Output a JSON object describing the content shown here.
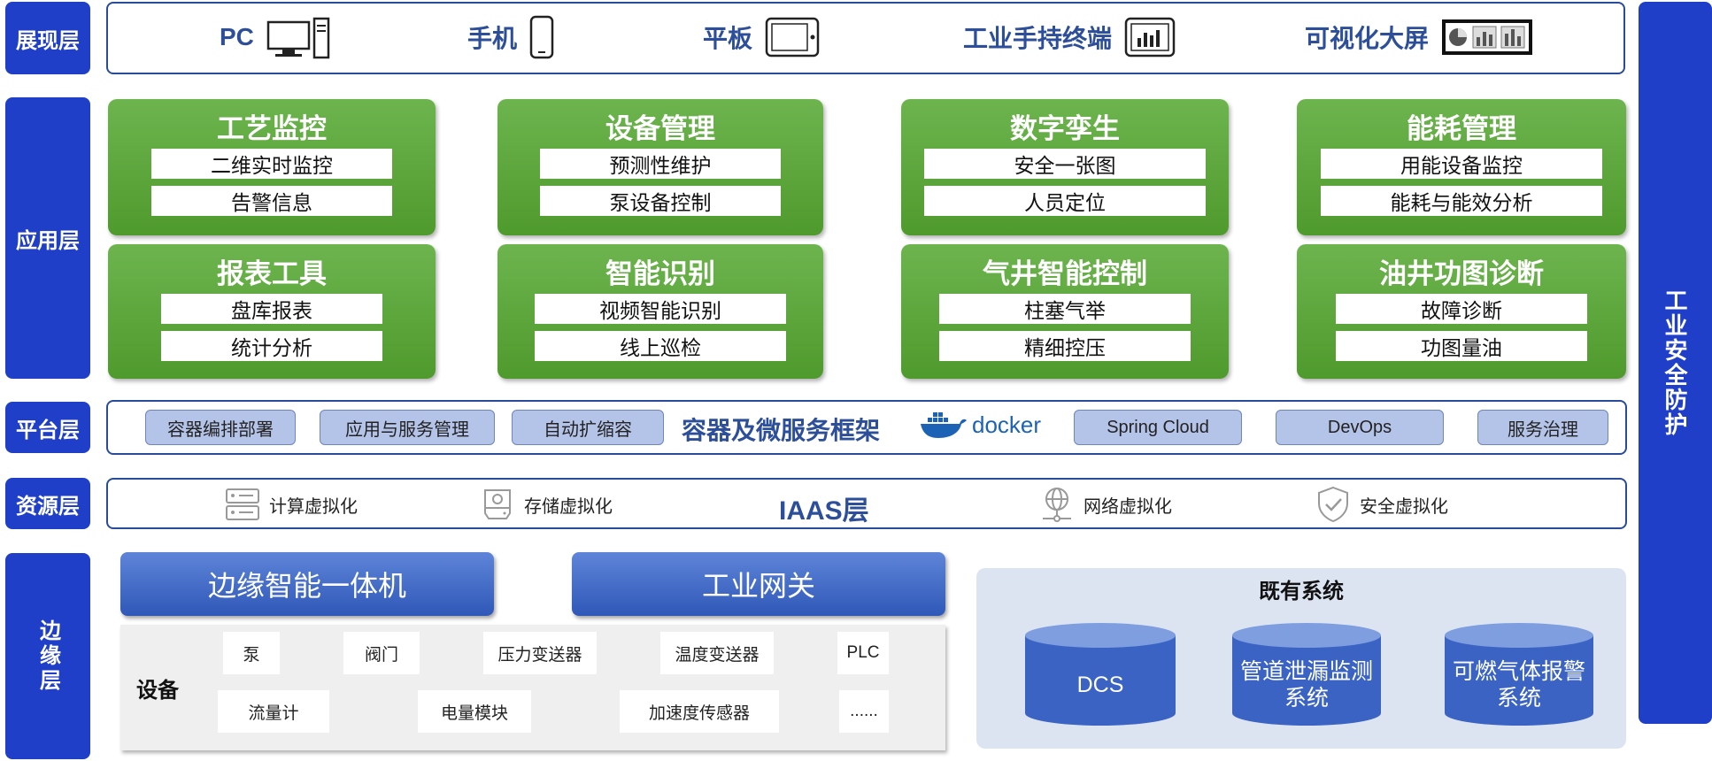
{
  "layers": {
    "presentation": "展现层",
    "application": "应用层",
    "platform": "平台层",
    "resource": "资源层",
    "edge": "边缘层"
  },
  "security": "工业安全防护",
  "presentation": {
    "devices": [
      {
        "label": "PC",
        "icon": "pc-icon"
      },
      {
        "label": "手机",
        "icon": "phone-icon"
      },
      {
        "label": "平板",
        "icon": "tablet-icon"
      },
      {
        "label": "工业手持终端",
        "icon": "handheld-terminal-icon"
      },
      {
        "label": "可视化大屏",
        "icon": "big-screen-icon"
      }
    ]
  },
  "application": {
    "modules": [
      {
        "title": "工艺监控",
        "items": [
          "二维实时监控",
          "告警信息"
        ]
      },
      {
        "title": "设备管理",
        "items": [
          "预测性维护",
          "泵设备控制"
        ]
      },
      {
        "title": "数字孪生",
        "items": [
          "安全一张图",
          "人员定位"
        ]
      },
      {
        "title": "能耗管理",
        "items": [
          "用能设备监控",
          "能耗与能效分析"
        ]
      },
      {
        "title": "报表工具",
        "items": [
          "盘库报表",
          "统计分析"
        ]
      },
      {
        "title": "智能识别",
        "items": [
          "视频智能识别",
          "线上巡检"
        ]
      },
      {
        "title": "气井智能控制",
        "items": [
          "柱塞气举",
          "精细控压"
        ]
      },
      {
        "title": "油井功图诊断",
        "items": [
          "故障诊断",
          "功图量油"
        ]
      }
    ]
  },
  "platform": {
    "title": "容器及微服务框架",
    "items": [
      "容器编排部署",
      "应用与服务管理",
      "自动扩缩容",
      "Spring Cloud",
      "DevOps",
      "服务治理"
    ],
    "docker_label": "docker"
  },
  "resource": {
    "title": "IAAS层",
    "items": [
      {
        "label": "计算虚拟化",
        "icon": "server-icon"
      },
      {
        "label": "存储虚拟化",
        "icon": "storage-icon"
      },
      {
        "label": "网络虚拟化",
        "icon": "network-icon"
      },
      {
        "label": "安全虚拟化",
        "icon": "shield-icon"
      }
    ]
  },
  "edge": {
    "edge_box": "边缘智能一体机",
    "gateway": "工业网关",
    "equipment_label": "设备",
    "equipment": [
      "泵",
      "阀门",
      "压力变送器",
      "温度变送器",
      "PLC",
      "流量计",
      "电量模块",
      "加速度传感器",
      "......"
    ],
    "legacy_title": "既有系统",
    "legacy": [
      "DCS",
      "管道泄漏监测\n系统",
      "可燃气体报警\n系统"
    ]
  },
  "colors": {
    "layer_blue": "#1f3fc9",
    "card_green": "#5aa63a",
    "title_blue": "#2d4f9a",
    "pill_blue": "#b4c3e8"
  }
}
